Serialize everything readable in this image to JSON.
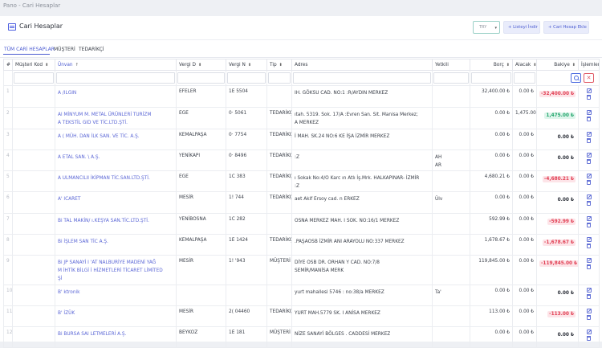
{
  "breadcrumb": "Pano - Cari Hesaplar",
  "page_title": "Cari Hesaplar",
  "currency_select": {
    "value": "TRY"
  },
  "buttons": {
    "download_list": "Listeyi İndir",
    "add_account": "Cari Hesap Ekle"
  },
  "tabs": [
    {
      "label": "TÜM CARİ HESAPLAR",
      "active": true
    },
    {
      "label": "MÜŞTERİ",
      "active": false
    },
    {
      "label": "TEDARİKÇİ",
      "active": false
    }
  ],
  "columns": {
    "num": "#",
    "code": "Müşteri Kod",
    "title": "Ünvan",
    "tax_office": "Vergi D",
    "tax_no": "Vergi N",
    "type": "Tip",
    "address": "Adres",
    "contact": "Yetkili",
    "debit": "Borç",
    "credit": "Alacak",
    "balance": "Bakiye",
    "actions": "İşlemler"
  },
  "rows": [
    {
      "num": "1",
      "code": "",
      "title": [
        "A​ /ILGIN"
      ],
      "tax_office": "EFELER",
      "tax_no": "1E     5504",
      "type": "",
      "address": "IH. GÖKSU CAD. NO:1              :R/AYDIN MERKEZ",
      "contact": "",
      "debit": "32,400.00 ₺",
      "credit": "0.00 ₺",
      "balance": "-32,400.00 ₺",
      "sign": "neg"
    },
    {
      "num": "2",
      "code": "",
      "title": [
        "Al     MİNYUM M.        METAL ÜRÜNLERİ TURİZM",
        "A      TEKSTİL GID           VE TİC.LTD.ŞTİ."
      ],
      "tax_office": "EGE",
      "tax_no": "0·     5061",
      "type": "TEDARİKÇİ",
      "address": "ıtah. 5319. Sok. 17/A              :Evren San. Sit. Manisa Merkez;",
      "address2": "A MERKEZ",
      "contact": "",
      "debit": "0.00 ₺",
      "credit": "1,475.00 ₺",
      "balance": "1,475.00 ₺",
      "sign": "pos"
    },
    {
      "num": "3",
      "code": "",
      "title": [
        "A​      ( MÜH. DAN          İLK SAN. VE TİC. A.Ş."
      ],
      "tax_office": "KEMALPAŞA",
      "tax_no": "0·     7754",
      "type": "TEDARİKÇİ",
      "address": "İ MAH. SK.24 NO:6 KE             İŞA İZMİR MERKEZ",
      "contact": "",
      "debit": "0.00 ₺",
      "credit": "0.00 ₺",
      "balance": "0.00 ₺",
      "sign": "zero"
    },
    {
      "num": "4",
      "code": "",
      "title": [
        "A​      ETAL SAN. \\         A.Ş."
      ],
      "tax_office": "YENİKAPI",
      "tax_no": "0·     8496",
      "type": "TEDARİKÇİ",
      "address": ":Z",
      "contact": "AH\nAR",
      "debit": "0.00 ₺",
      "credit": "0.00 ₺",
      "balance": "0.00 ₺",
      "sign": "zero"
    },
    {
      "num": "5",
      "code": "",
      "title": [
        "A​      ULMANCILII           İKİPMAN TİC.SAN.LTD.ŞTİ."
      ],
      "tax_office": "EGE",
      "tax_no": "1C     383",
      "type": "TEDARİKÇİ",
      "address": "ı Sokak No:4/O Karc             ın Atlı İş.Mrk. HALKAPINAR- İZMİR",
      "address2": ":Z",
      "contact": "",
      "debit": "4,680.21 ₺",
      "credit": "0.00 ₺",
      "balance": "-4,680.21 ₺",
      "sign": "neg"
    },
    {
      "num": "6",
      "code": "",
      "title": [
        "A'      ICARET"
      ],
      "tax_office": "MESİR",
      "tax_no": "1!     744",
      "type": "TEDARİKÇİ",
      "address": "aet Akif Ersoy cad. n             ERKEZ",
      "contact": "Ülv",
      "debit": "0.00 ₺",
      "credit": "0.00 ₺",
      "balance": "0.00 ₺",
      "sign": "zero"
    },
    {
      "num": "7",
      "code": "",
      "title": [
        "Bi      TAL MAKİN/            ı.KEŞYA SAN.TİC.LTD.ŞTİ."
      ],
      "tax_office": "YENİBOSNA",
      "tax_no": "1C     282",
      "type": "",
      "address": "OSNA MERKEZ MAH. I             SOK. NO:16/1 MERKEZ",
      "contact": "",
      "debit": "592.99 ₺",
      "credit": "0.00 ₺",
      "balance": "-592.99 ₺",
      "sign": "neg"
    },
    {
      "num": "8",
      "code": "",
      "title": [
        "Bi      İŞLEM SAN           TİC A.Ş."
      ],
      "tax_office": "KEMALPAŞA",
      "tax_no": "1E     1424",
      "type": "TEDARİKÇİ",
      "address": ".PAŞAOSB İZMİR ANI             ARAYOLU NO:337 MERKEZ",
      "contact": "",
      "debit": "1,678.67 ₺",
      "credit": "0.00 ₺",
      "balance": "-1,678.67 ₺",
      "sign": "neg"
    },
    {
      "num": "9",
      "code": "",
      "title": [
        "Bi      JP SANAYİ I        'AT NALBURİYE MADENİ YAĞ",
        "M       İHTİK BİLGİ        İ HİZMETLERİ TİCARET LİMİTED",
        "Şİ"
      ],
      "tax_office": "MESİR",
      "tax_no": "1!     '943",
      "type": "MÜŞTERİ",
      "address": "DİYE OSB DR. ORHAN             Y CAD. NO:7/8",
      "address2": "SEMİR/MANİSA MERK",
      "contact": "",
      "debit": "119,845.00 ₺",
      "credit": "0.00 ₺",
      "balance": "-119,845.00 ₺",
      "sign": "neg"
    },
    {
      "num": "10",
      "code": "",
      "title": [
        "B'      ktronik"
      ],
      "tax_office": "",
      "tax_no": "",
      "type": "",
      "address": "yurt mahallesi 5746            : no:38/a MERKEZ",
      "contact": "Ta'",
      "debit": "0.00 ₺",
      "credit": "0.00 ₺",
      "balance": "0.00 ₺",
      "sign": "zero"
    },
    {
      "num": "11",
      "code": "",
      "title": [
        "B'      İZÜK"
      ],
      "tax_office": "MESİR",
      "tax_no": "2(     04460",
      "type": "TEDARİKÇİ",
      "address": "YURT MAH.5779 SK. I             ANİSA MERKEZ",
      "contact": "",
      "debit": "113.00 ₺",
      "credit": "0.00 ₺",
      "balance": "-113.00 ₺",
      "sign": "neg"
    },
    {
      "num": "12",
      "code": "",
      "title": [
        "Bi      BURSA SAI          LETMELERİ A.Ş."
      ],
      "tax_office": "BEYKOZ",
      "tax_no": "1E     181",
      "type": "MÜŞTERİ",
      "address": "NİZE SANAYİ BÖLGES             . CADDESİ MERKEZ",
      "contact": "",
      "debit": "0.00 ₺",
      "credit": "0.00 ₺",
      "balance": "0.00 ₺",
      "sign": "zero"
    }
  ],
  "colors": {
    "accent": "#4b5bd1",
    "negative": "#e14155",
    "positive": "#25a76e"
  }
}
